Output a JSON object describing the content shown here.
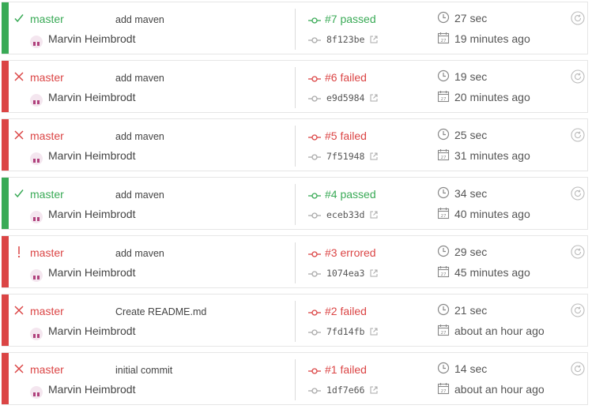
{
  "builds": [
    {
      "state": "passed",
      "status_icon": "check-icon",
      "branch": "master",
      "message": "add maven",
      "author": "Marvin Heimbrodt",
      "build": "#7 passed",
      "commit": "8f123be",
      "duration": "27 sec",
      "finished": "19 minutes ago"
    },
    {
      "state": "failed",
      "status_icon": "cross-icon",
      "branch": "master",
      "message": "add maven",
      "author": "Marvin Heimbrodt",
      "build": "#6 failed",
      "commit": "e9d5984",
      "duration": "19 sec",
      "finished": "20 minutes ago"
    },
    {
      "state": "failed",
      "status_icon": "cross-icon",
      "branch": "master",
      "message": "add maven",
      "author": "Marvin Heimbrodt",
      "build": "#5 failed",
      "commit": "7f51948",
      "duration": "25 sec",
      "finished": "31 minutes ago"
    },
    {
      "state": "passed",
      "status_icon": "check-icon",
      "branch": "master",
      "message": "add maven",
      "author": "Marvin Heimbrodt",
      "build": "#4 passed",
      "commit": "eceb33d",
      "duration": "34 sec",
      "finished": "40 minutes ago"
    },
    {
      "state": "errored",
      "status_icon": "exclamation-icon",
      "branch": "master",
      "message": "add maven",
      "author": "Marvin Heimbrodt",
      "build": "#3 errored",
      "commit": "1074ea3",
      "duration": "29 sec",
      "finished": "45 minutes ago"
    },
    {
      "state": "failed",
      "status_icon": "cross-icon",
      "branch": "master",
      "message": "Create README.md",
      "author": "Marvin Heimbrodt",
      "build": "#2 failed",
      "commit": "7fd14fb",
      "duration": "21 sec",
      "finished": "about an hour ago"
    },
    {
      "state": "failed",
      "status_icon": "cross-icon",
      "branch": "master",
      "message": "initial commit",
      "author": "Marvin Heimbrodt",
      "build": "#1 failed",
      "commit": "1df7e66",
      "duration": "14 sec",
      "finished": "about an hour ago"
    }
  ],
  "colors": {
    "passed": "#39aa56",
    "failed": "#db4545",
    "errored": "#db4545"
  }
}
